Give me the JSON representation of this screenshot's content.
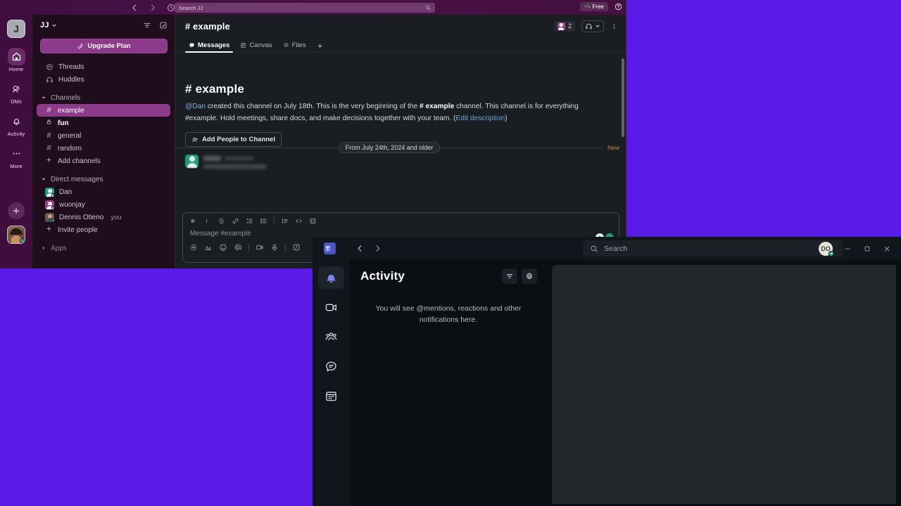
{
  "desktop": {
    "background_color": "#5b1be6"
  },
  "slack": {
    "topbar": {
      "back_icon": "arrow-left-icon",
      "forward_icon": "arrow-right-icon",
      "history_icon": "clock-icon",
      "search_placeholder": "Search JJ",
      "search_icon": "search-icon",
      "plan_badge": "Free",
      "help_icon": "help-icon"
    },
    "rail": {
      "workspace_initial": "J",
      "items": [
        {
          "label": "Home",
          "icon": "home-icon",
          "active": true,
          "badge": true
        },
        {
          "label": "DMs",
          "icon": "dm-icon",
          "active": false,
          "badge": false
        },
        {
          "label": "Activity",
          "icon": "bell-icon",
          "active": false,
          "badge": false
        },
        {
          "label": "More",
          "icon": "ellipsis-icon",
          "active": false,
          "badge": false
        }
      ],
      "add_label": "add-icon",
      "avatar_label": "user-avatar"
    },
    "sidebar": {
      "workspace_name": "JJ",
      "workspace_chevron": "chevron-down-icon",
      "filter_icon": "filter-icon",
      "compose_icon": "compose-icon",
      "upgrade_label": "Upgrade Plan",
      "upgrade_icon": "rocket-icon",
      "nav": [
        {
          "label": "Threads",
          "icon": "threads-icon"
        },
        {
          "label": "Huddles",
          "icon": "headphones-icon"
        }
      ],
      "channels_section": "Channels",
      "channels": [
        {
          "label": "example",
          "prefix": "#",
          "active": true,
          "bold": false
        },
        {
          "label": "fun",
          "prefix": "lock",
          "active": false,
          "bold": true
        },
        {
          "label": "general",
          "prefix": "#",
          "active": false,
          "bold": false
        },
        {
          "label": "random",
          "prefix": "#",
          "active": false,
          "bold": false
        }
      ],
      "add_channels_label": "Add channels",
      "dm_section": "Direct messages",
      "dms": [
        {
          "name": "Dan",
          "color": "#1f9e7e",
          "presence": "away",
          "suffix": ""
        },
        {
          "name": "wuonjay",
          "color": "#9c3f9a",
          "presence": "away",
          "suffix": ""
        },
        {
          "name": "Dennis Otieno",
          "color": "#6b5847",
          "presence": "online",
          "suffix": "you"
        }
      ],
      "invite_label": "Invite people",
      "apps_section": "Apps"
    },
    "channel": {
      "title": "# example",
      "member_count": "2",
      "huddle_icon": "headphones-icon",
      "huddle_chevron": "chevron-down-icon",
      "more_icon": "kebab-menu-icon",
      "tabs": [
        {
          "label": "Messages",
          "icon": "messages-icon",
          "active": true
        },
        {
          "label": "Canvas",
          "icon": "canvas-icon",
          "active": false
        },
        {
          "label": "Files",
          "icon": "files-icon",
          "active": false
        },
        {
          "label": "",
          "icon": "plus-icon",
          "active": false
        }
      ],
      "intro_title": "# example",
      "intro_mention": "@Dan",
      "intro_text_1": " created this channel on July 18th. This is the very beginning of the ",
      "intro_channel_bold": "# example",
      "intro_text_2": " channel. This channel is for everything #example. Hold meetings, share docs, and make decisions together with your team. (",
      "intro_link": "Edit description",
      "intro_text_3": ")",
      "add_people_label": "Add People to Channel",
      "add_people_icon": "add-person-icon",
      "divider_label": "From July 24th, 2024 and older",
      "new_label": "New"
    },
    "composer": {
      "placeholder": "Message #example",
      "format_icons": [
        "bold-icon",
        "italic-icon",
        "strikethrough-icon",
        "link-icon",
        "ordered-list-icon",
        "bulleted-list-icon",
        "blockquote-icon",
        "code-icon",
        "code-block-icon"
      ],
      "action_icons": [
        "plus-icon",
        "format-text-icon",
        "emoji-icon",
        "mention-icon",
        "video-icon",
        "microphone-icon",
        "slash-command-icon"
      ],
      "send_icons": [
        "record-icon",
        "send-icon"
      ]
    }
  },
  "teams": {
    "titlebar": {
      "logo": "teams-logo-icon",
      "back_icon": "chevron-left-icon",
      "forward_icon": "chevron-right-icon",
      "search_placeholder": "Search",
      "search_icon": "search-icon",
      "more_icon": "ellipsis-icon",
      "avatar_initials": "DO",
      "minimize_icon": "minimize-icon",
      "maximize_icon": "maximize-icon",
      "close_icon": "close-icon"
    },
    "rail": [
      {
        "icon": "bell-icon",
        "name": "activity",
        "active": true
      },
      {
        "icon": "video-camera-icon",
        "name": "meet",
        "active": false
      },
      {
        "icon": "people-icon",
        "name": "communities",
        "active": false
      },
      {
        "icon": "chat-icon",
        "name": "chat",
        "active": false
      },
      {
        "icon": "calendar-icon",
        "name": "calendar",
        "active": false
      }
    ],
    "panel": {
      "title": "Activity",
      "filter_icon": "filter-icon",
      "settings_icon": "gear-icon",
      "empty_text": "You will see @mentions, reactions and other notifications here."
    }
  }
}
